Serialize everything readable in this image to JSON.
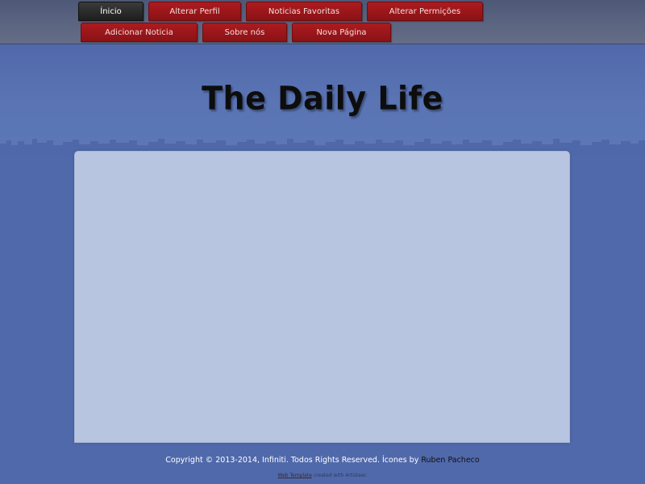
{
  "nav": {
    "row1": [
      {
        "label": "Ínicio",
        "active": true
      },
      {
        "label": "Alterar Perfil",
        "active": false
      },
      {
        "label": "Noticias Favoritas",
        "active": false
      },
      {
        "label": "Alterar Permições",
        "active": false
      }
    ],
    "row2": [
      {
        "label": "Adicionar Noticia",
        "active": false
      },
      {
        "label": "Sobre nós",
        "active": false
      },
      {
        "label": "Nova Página",
        "active": false
      }
    ]
  },
  "header": {
    "title": "The Daily Life"
  },
  "footer": {
    "copyright": "Copyright © 2013-2014, Infiniti. Todos Rights Reserved. Ícones by ",
    "author": "Ruben Pacheco"
  },
  "credits": {
    "link_text": "Web Template",
    "rest": " created with Artisteer."
  },
  "colors": {
    "background": "#5069ab",
    "nav_tab": "#ad1b1f",
    "nav_tab_active": "#2a2a2a",
    "content_panel": "#b8c5e0"
  }
}
